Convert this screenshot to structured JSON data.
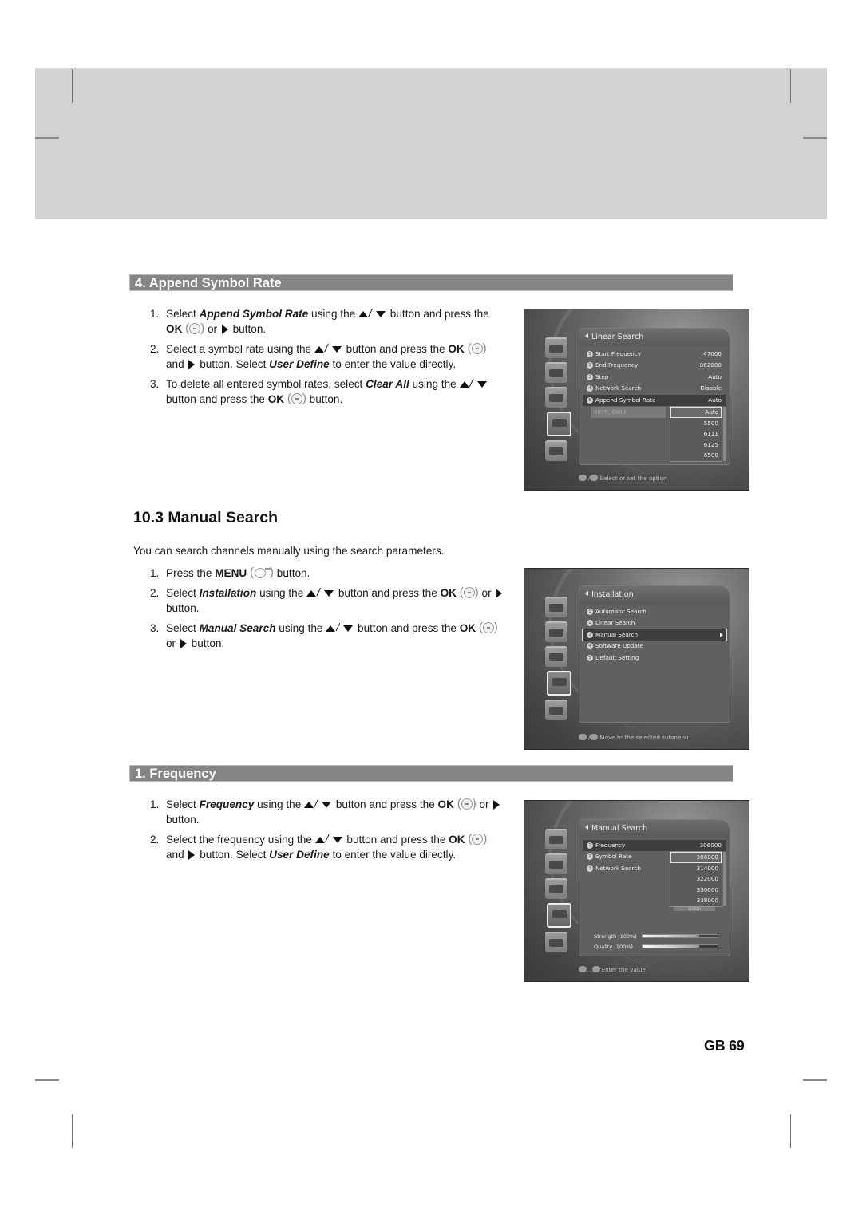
{
  "sections": {
    "append_symbol_rate": {
      "title": "4. Append Symbol Rate",
      "steps": [
        {
          "num": "1.",
          "p1": "Select ",
          "em1": "Append Symbol Rate",
          "p2": " using the ",
          "p3": " button and press the ",
          "kw1": "OK",
          "p4": " or ",
          "p5": " button."
        },
        {
          "num": "2.",
          "p1": "Select a symbol rate using the ",
          "p2": " button and press the ",
          "kw1": "OK",
          "p3": " and ",
          "p4": " button. Select ",
          "em1": "User Define",
          "p5": " to enter the value directly."
        },
        {
          "num": "3.",
          "p1": "To delete all entered symbol rates, select ",
          "em1": "Clear All",
          "p2": " using the ",
          "p3": " button and press the ",
          "kw1": "OK",
          "p4": " button."
        }
      ]
    },
    "manual_search": {
      "title": "10.3 Manual Search",
      "intro": "You can search channels manually using the search parameters.",
      "steps": [
        {
          "num": "1.",
          "p1": "Press the ",
          "kw1": "MENU",
          "p2": " button."
        },
        {
          "num": "2.",
          "p1": "Select ",
          "em1": "Installation",
          "p2": " using the ",
          "p3": " button and press the ",
          "kw1": "OK",
          "p4": " or ",
          "p5": " button."
        },
        {
          "num": "3.",
          "p1": "Select ",
          "em1": "Manual Search",
          "p2": " using the ",
          "p3": " button and press the ",
          "kw1": "OK",
          "p4": " or ",
          "p5": " button."
        }
      ]
    },
    "frequency": {
      "title": "1. Frequency",
      "steps": [
        {
          "num": "1.",
          "p1": "Select ",
          "em1": "Frequency",
          "p2": " using the ",
          "p3": " button and press the ",
          "kw1": "OK",
          "p4": " or ",
          "p5": " button."
        },
        {
          "num": "2.",
          "p1": "Select the frequency using the ",
          "p2": " button and press the ",
          "kw1": "OK",
          "p3": " and ",
          "p4": " button. Select ",
          "em1": "User Define",
          "p5": " to enter the value directly."
        }
      ]
    }
  },
  "screens": {
    "linear_search": {
      "title": "Linear Search",
      "rows": [
        {
          "n": "1",
          "label": "Start Frequency",
          "value": "47000"
        },
        {
          "n": "2",
          "label": "End Frequency",
          "value": "862000"
        },
        {
          "n": "3",
          "label": "Step",
          "value": "Auto"
        },
        {
          "n": "4",
          "label": "Network Search",
          "value": "Disable"
        },
        {
          "n": "5",
          "label": "Append Symbol Rate",
          "value": "Auto"
        }
      ],
      "entered_rates": "6875, 6900",
      "options": [
        "Auto",
        "5500",
        "6111",
        "6125",
        "6500"
      ],
      "hint": "Select or set the option"
    },
    "installation": {
      "title": "Installation",
      "rows": [
        {
          "n": "1",
          "label": "Automatic Search"
        },
        {
          "n": "2",
          "label": "Linear Search"
        },
        {
          "n": "3",
          "label": "Manual Search"
        },
        {
          "n": "4",
          "label": "Software Update"
        },
        {
          "n": "5",
          "label": "Default Setting"
        }
      ],
      "hint": "Move to the selected submenu"
    },
    "manual_search": {
      "title": "Manual Search",
      "rows": [
        {
          "n": "1",
          "label": "Frequency",
          "value": "306000"
        },
        {
          "n": "2",
          "label": "Symbol Rate"
        },
        {
          "n": "3",
          "label": "Network Search"
        }
      ],
      "options": [
        "306000",
        "314000",
        "322000",
        "330000",
        "338000"
      ],
      "below_options": "SEARCH",
      "strength_label": "Strength (100%)",
      "strength": 0.75,
      "quality_label": "Quality (100%)",
      "quality": 0.75,
      "hint": "Enter the value"
    }
  },
  "footer": {
    "page_number": "GB 69"
  }
}
